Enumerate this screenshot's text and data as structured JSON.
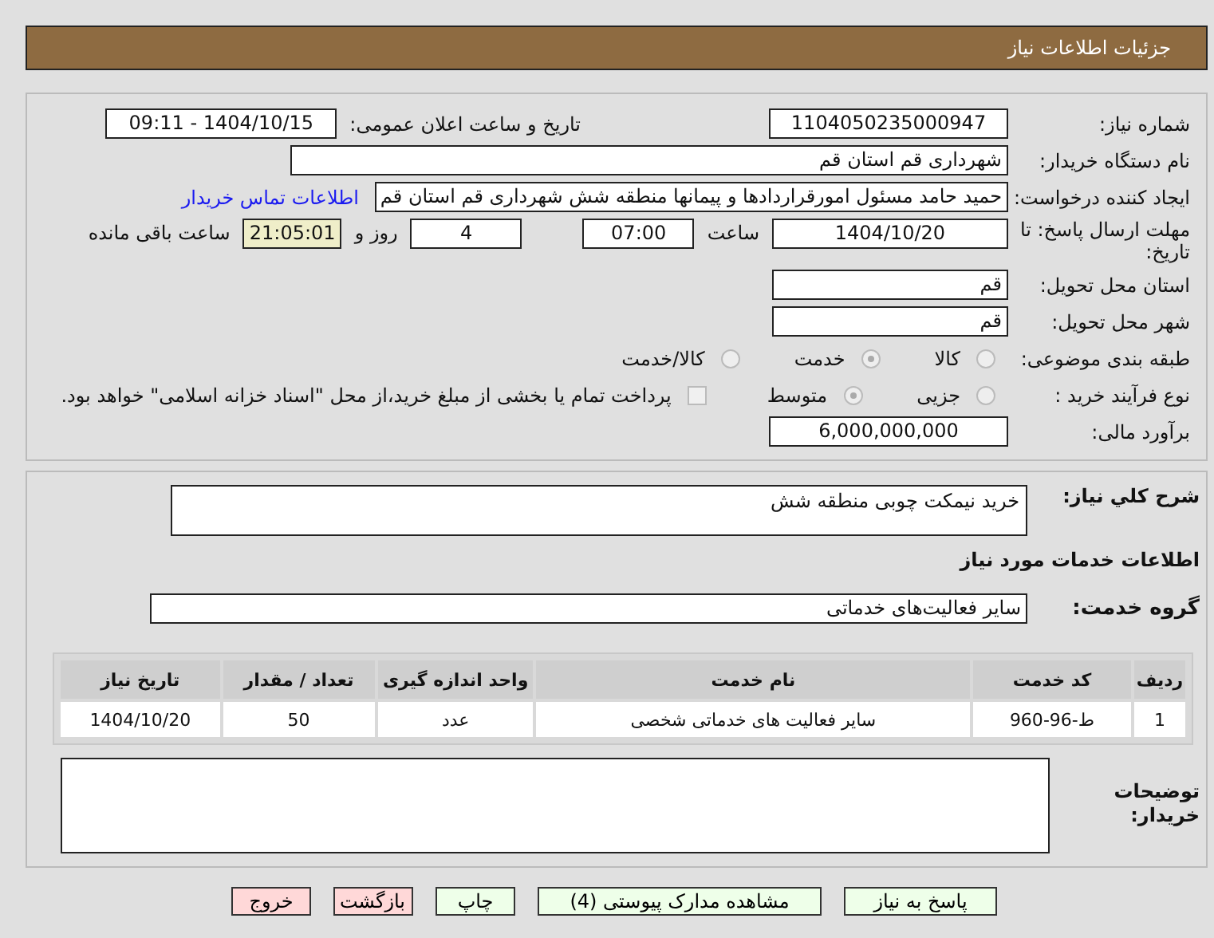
{
  "header": {
    "title": "جزئیات اطلاعات نیاز"
  },
  "need_number": {
    "label": "شماره نیاز:",
    "value": "1104050235000947"
  },
  "announce": {
    "label": "تاریخ و ساعت اعلان عمومی:",
    "value": "1404/10/15 - 09:11"
  },
  "buyer_org": {
    "label": "نام دستگاه خریدار:",
    "value": "شهرداری قم استان قم"
  },
  "requester": {
    "label": "ایجاد کننده درخواست:",
    "value": "حمید حامد مسئول امورقراردادها و پیمانها منطقه شش شهرداری قم استان قم",
    "link": "اطلاعات تماس خریدار"
  },
  "deadline": {
    "label": "مهلت ارسال پاسخ: تا تاریخ:",
    "date": "1404/10/20",
    "time_label": "ساعت",
    "time": "07:00",
    "days": "4",
    "days_label": "روز و",
    "remaining": "21:05:01",
    "remaining_label": "ساعت باقی مانده"
  },
  "province": {
    "label": "استان محل تحویل:",
    "value": "قم"
  },
  "city": {
    "label": "شهر محل تحویل:",
    "value": "قم"
  },
  "category": {
    "label": "طبقه بندی موضوعی:",
    "options": [
      {
        "label": "کالا",
        "selected": false
      },
      {
        "label": "خدمت",
        "selected": true
      },
      {
        "label": "کالا/خدمت",
        "selected": false
      }
    ]
  },
  "process": {
    "label": "نوع فرآیند خرید :",
    "options": [
      {
        "label": "جزیی",
        "selected": false
      },
      {
        "label": "متوسط",
        "selected": true
      }
    ],
    "treasury": {
      "checked": false,
      "label": "پرداخت تمام یا بخشی از مبلغ خرید،از محل \"اسناد خزانه اسلامی\" خواهد بود."
    }
  },
  "budget": {
    "label": "برآورد مالی:",
    "value": "6,000,000,000"
  },
  "description": {
    "label": "شرح کلي نياز:",
    "value": "خرید نیمکت چوبی منطقه شش"
  },
  "services_title": "اطلاعات خدمات مورد نیاز",
  "service_group": {
    "label": "گروه خدمت:",
    "value": "سایر فعالیت‌های خدماتی"
  },
  "table": {
    "columns": [
      "ردیف",
      "کد خدمت",
      "نام خدمت",
      "واحد اندازه گیری",
      "تعداد / مقدار",
      "تاریخ نیاز"
    ],
    "rows": [
      [
        "1",
        "ط-96-960",
        "سایر فعالیت های خدماتی شخصی",
        "عدد",
        "50",
        "1404/10/20"
      ]
    ]
  },
  "buyer_notes": {
    "label": "توضیحات خریدار:"
  },
  "buttons": [
    {
      "label": "پاسخ به نیاز",
      "kind": "normal"
    },
    {
      "label": "مشاهده مدارک پیوستی (4)",
      "kind": "normal"
    },
    {
      "label": "چاپ",
      "kind": "normal"
    },
    {
      "label": "بازگشت",
      "kind": "danger"
    },
    {
      "label": "خروج",
      "kind": "danger"
    }
  ]
}
